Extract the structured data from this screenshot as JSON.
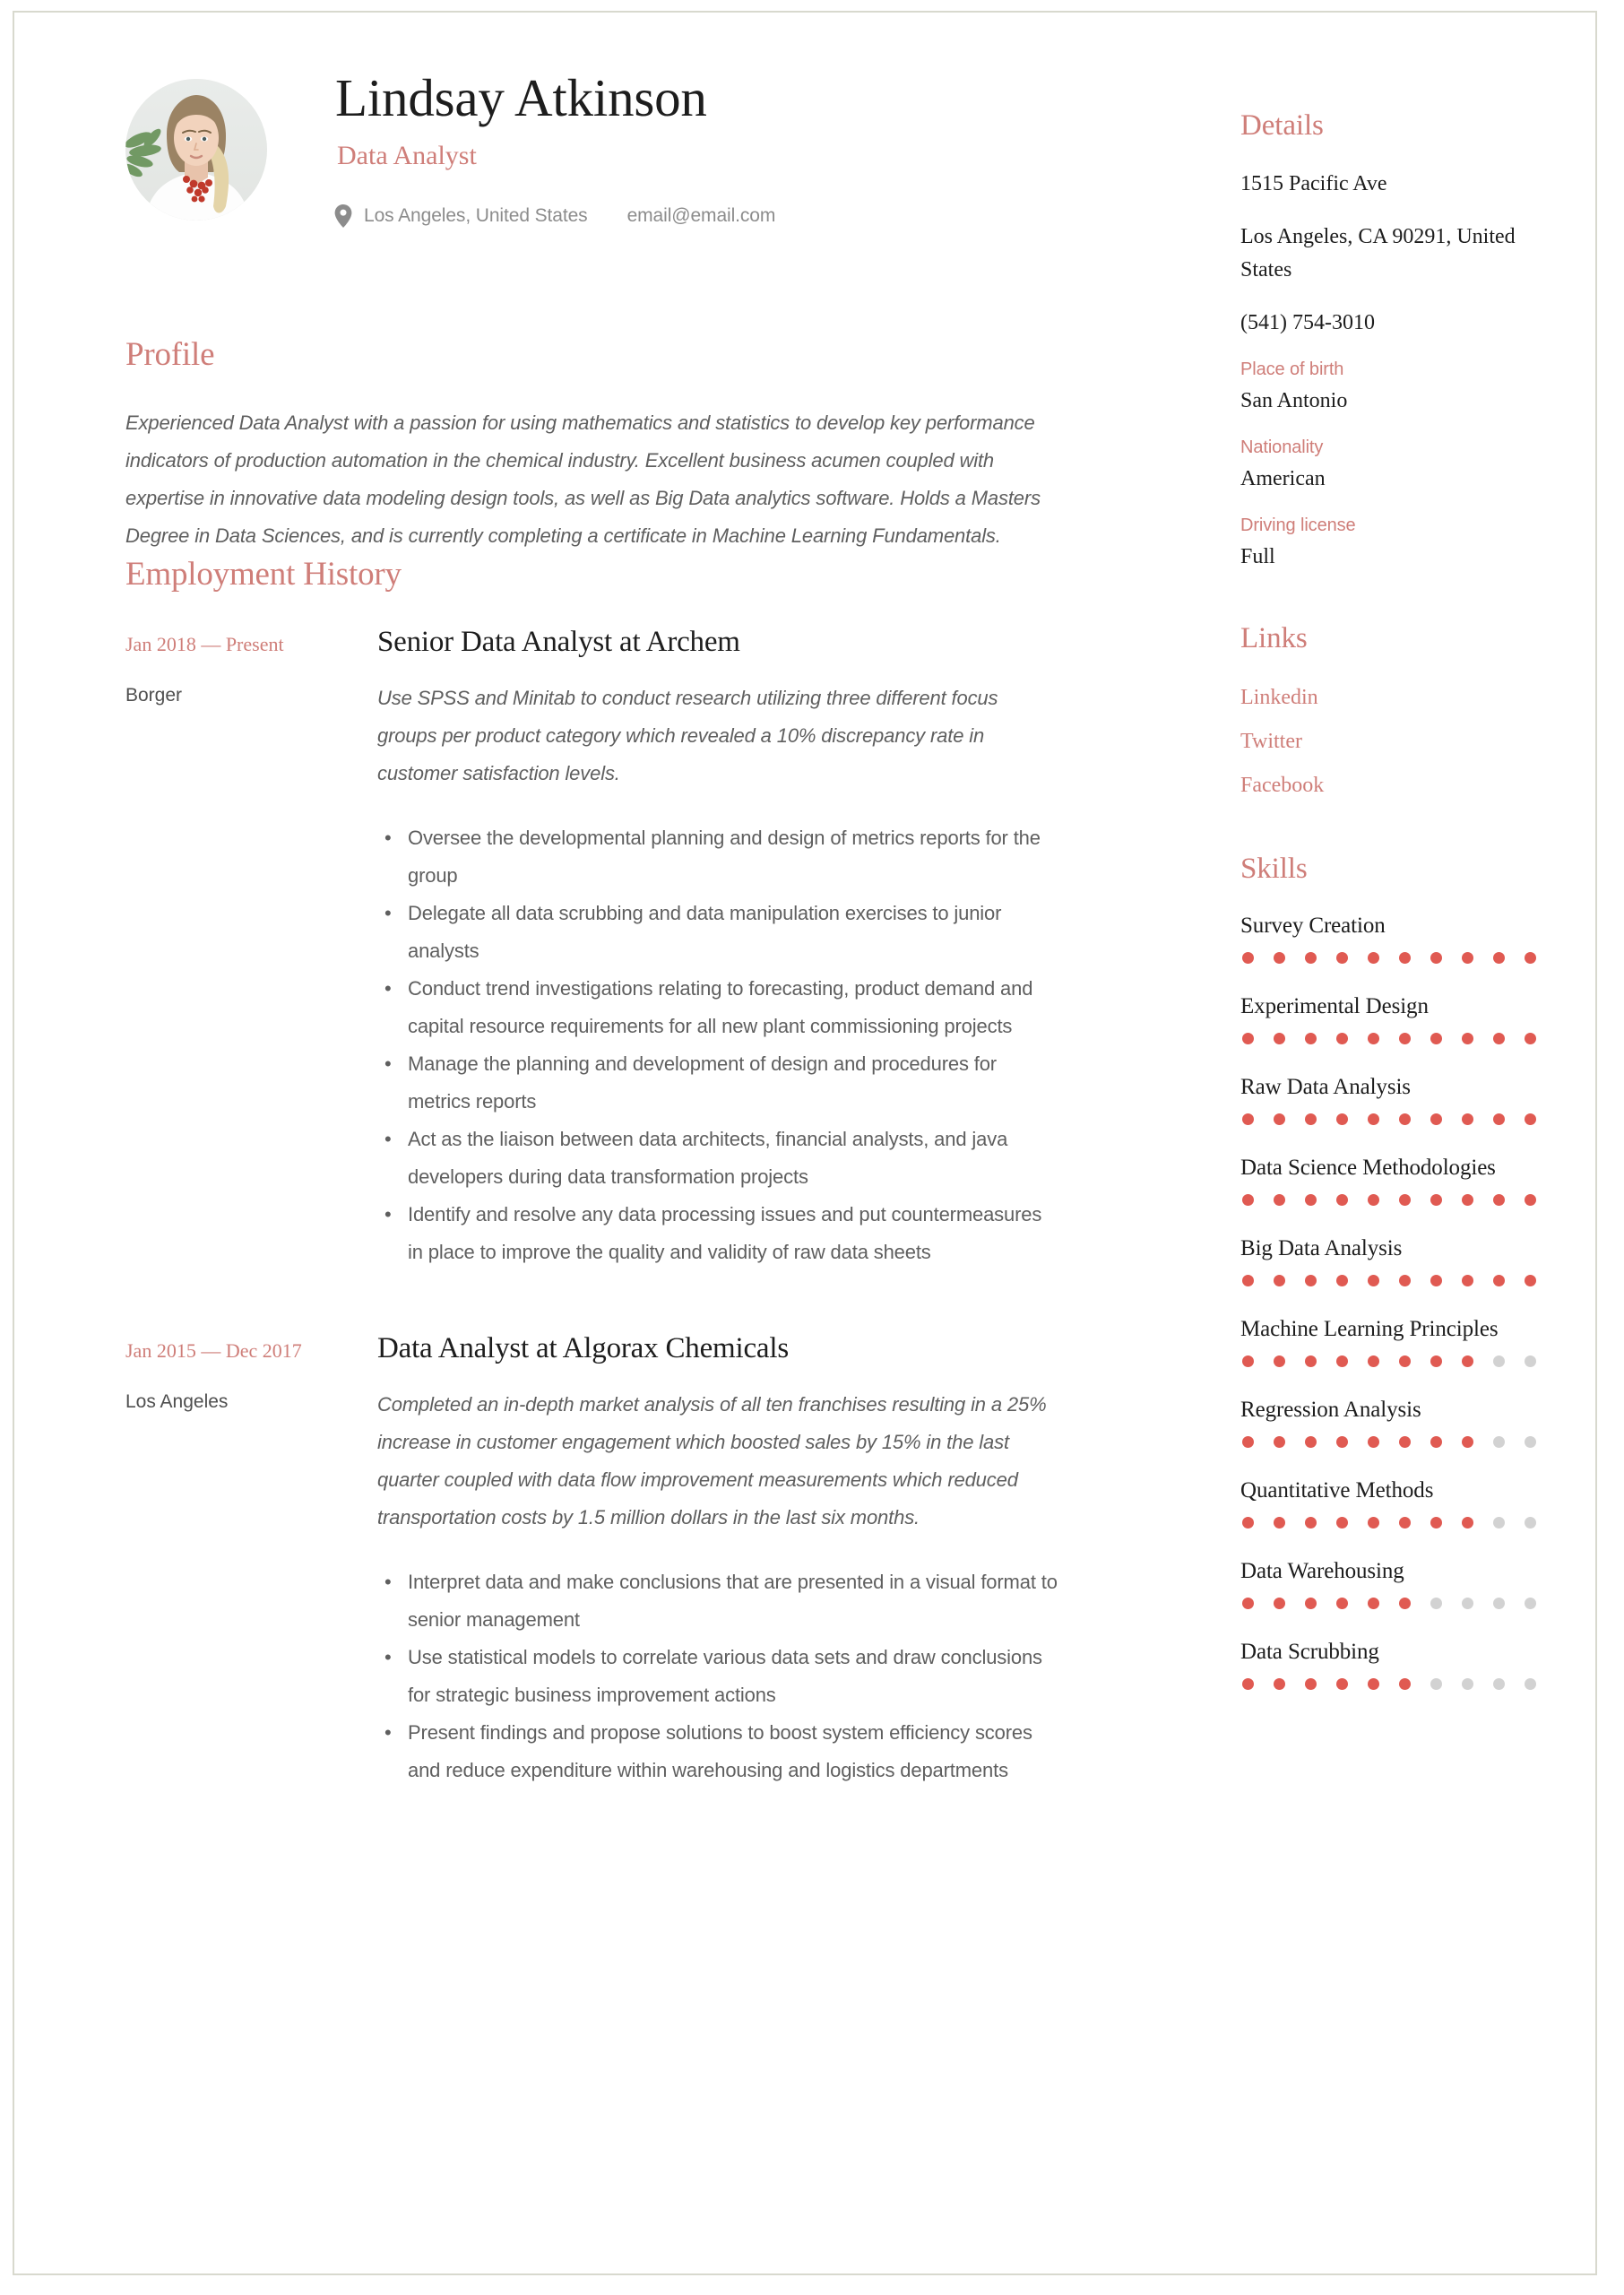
{
  "theme": {
    "accent": "#cf7e79",
    "dot_on": "#e05a52",
    "dot_off": "#d2d2d2",
    "text": "#1d1d1d",
    "body_text": "#5f5f5f"
  },
  "header": {
    "name": "Lindsay Atkinson",
    "job_title": "Data Analyst",
    "location_icon": "map-pin-icon",
    "location": "Los Angeles, United States",
    "email": "email@email.com",
    "photo_alt": "portrait of a woman in a white coat with a red beaded necklace"
  },
  "profile": {
    "heading": "Profile",
    "text": "Experienced Data Analyst with a passion for using mathematics and statistics to develop key performance indicators of production automation in the chemical industry.  Excellent business acumen coupled with expertise in innovative data modeling design tools, as well as Big Data analytics software.  Holds a Masters Degree in Data Sciences, and is currently completing a certificate in Machine Learning Fundamentals."
  },
  "employment": {
    "heading": "Employment History",
    "jobs": [
      {
        "dates": "Jan 2018 — Present",
        "location": "Borger",
        "title": "Senior Data Analyst at  Archem",
        "summary": "Use SPSS and Minitab to conduct research utilizing three different focus groups per product category which revealed a 10% discrepancy rate in customer satisfaction levels.",
        "bullets": [
          "Oversee the developmental planning and design of metrics reports for the group",
          "Delegate all data scrubbing and data manipulation exercises to junior analysts",
          "Conduct trend investigations relating to forecasting, product demand and capital resource requirements for all new plant commissioning projects",
          "Manage the planning and development of design and procedures for metrics reports",
          "Act as the liaison between data architects, financial analysts, and java developers during data transformation projects",
          "Identify and resolve any data processing issues and put countermeasures in place to improve the quality and validity of raw data sheets"
        ]
      },
      {
        "dates": "Jan 2015 — Dec 2017",
        "location": "Los Angeles",
        "title": "Data Analyst at  Algorax Chemicals",
        "summary": "Completed an in-depth market analysis of all ten franchises resulting in a 25% increase in customer engagement which boosted sales by 15% in the last quarter coupled with data flow improvement measurements which reduced transportation costs by 1.5 million dollars in the last six months.",
        "bullets": [
          "Interpret data and make conclusions that are presented in a visual format to senior management",
          "Use statistical models to correlate various data sets and draw conclusions for strategic business improvement actions",
          "Present findings and propose solutions to boost system efficiency scores and reduce expenditure within warehousing and logistics departments"
        ]
      }
    ]
  },
  "details": {
    "heading": "Details",
    "address_line1": "1515 Pacific Ave",
    "address_line2": "Los Angeles, CA 90291, United States",
    "phone": "(541) 754-3010",
    "fields": [
      {
        "label": "Place of birth",
        "value": "San Antonio"
      },
      {
        "label": "Nationality",
        "value": "American"
      },
      {
        "label": "Driving license",
        "value": "Full"
      }
    ]
  },
  "links": {
    "heading": "Links",
    "items": [
      {
        "label": "Linkedin"
      },
      {
        "label": "Twitter"
      },
      {
        "label": "Facebook"
      }
    ]
  },
  "skills": {
    "heading": "Skills",
    "max": 10,
    "items": [
      {
        "name": "Survey Creation",
        "level": 10
      },
      {
        "name": "Experimental Design",
        "level": 10
      },
      {
        "name": "Raw Data Analysis",
        "level": 10
      },
      {
        "name": "Data Science Methodologies",
        "level": 10
      },
      {
        "name": "Big Data Analysis",
        "level": 10
      },
      {
        "name": "Machine Learning Principles",
        "level": 8
      },
      {
        "name": "Regression Analysis",
        "level": 8
      },
      {
        "name": "Quantitative Methods",
        "level": 8
      },
      {
        "name": "Data Warehousing",
        "level": 6
      },
      {
        "name": "Data Scrubbing",
        "level": 6
      }
    ]
  }
}
